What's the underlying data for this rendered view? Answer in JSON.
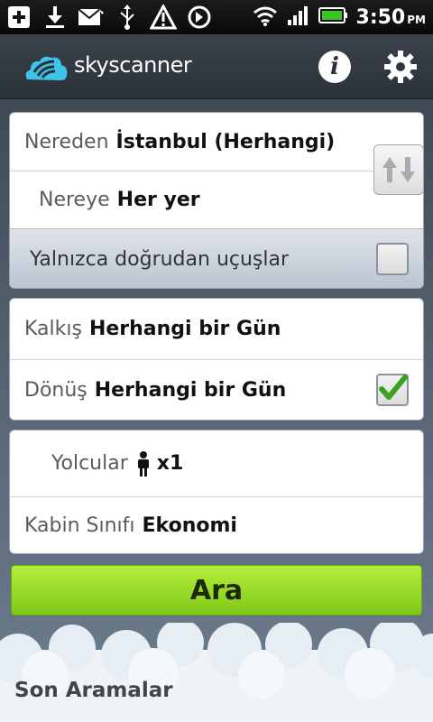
{
  "status_bar": {
    "time": "3:50",
    "ampm": "PM",
    "icons": [
      "add-icon",
      "download-icon",
      "mail-icon",
      "usb-icon",
      "warning-icon",
      "sync-icon",
      "wifi-icon",
      "signal-icon",
      "battery-icon"
    ]
  },
  "header": {
    "brand": "skyscanner",
    "info_icon": "info-icon",
    "settings_icon": "gear-icon"
  },
  "route": {
    "from_label": "Nereden",
    "from_value": "İstanbul (Herhangi)",
    "to_label": "Nereye",
    "to_value": "Her yer",
    "direct_label": "Yalnızca doğrudan uçuşlar",
    "direct_checked": false,
    "swap_icon": "swap-arrows-icon"
  },
  "dates": {
    "depart_label": "Kalkış",
    "depart_value": "Herhangi bir Gün",
    "return_label": "Dönüş",
    "return_value": "Herhangi bir Gün",
    "return_checked": true
  },
  "passengers": {
    "label": "Yolcular",
    "count": "x1",
    "person_icon": "person-icon",
    "cabin_label": "Kabin Sınıfı",
    "cabin_value": "Ekonomi"
  },
  "search_button": "Ara",
  "recent_title": "Son Aramalar",
  "colors": {
    "accent_green": "#8fd626",
    "brand_blue": "#3fc3e8",
    "check_green": "#3aa320"
  }
}
